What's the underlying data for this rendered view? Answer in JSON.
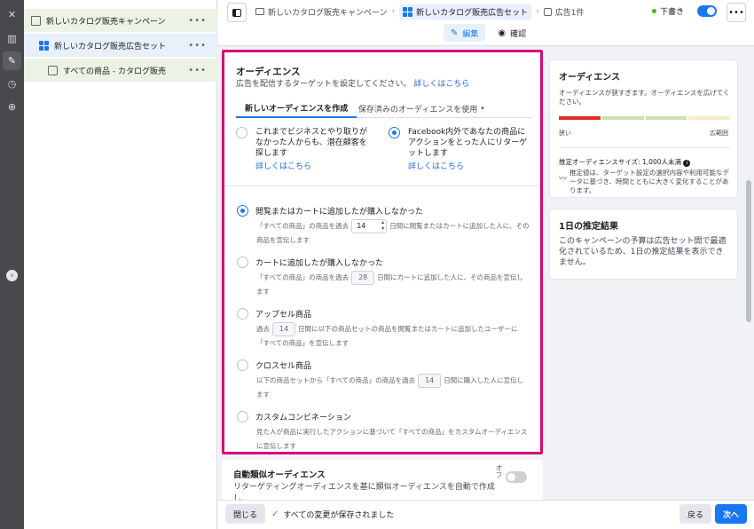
{
  "rail": {
    "icons": [
      "close-icon",
      "chart-icon",
      "pencil-icon",
      "clock-icon",
      "zoom-icon"
    ],
    "close_glyph": "✕",
    "chart_glyph": "▥",
    "pencil_glyph": "✎",
    "clock_glyph": "◷",
    "zoom_glyph": "⊕",
    "collapse_glyph": "‹"
  },
  "tree": {
    "campaign": "新しいカタログ販売キャンペーン",
    "adset": "新しいカタログ販売広告セット",
    "ad": "すべての商品 - カタログ販売",
    "more": "•••"
  },
  "header": {
    "breadcrumbs": [
      "新しいカタログ販売キャンペーン",
      "新しいカタログ販売広告セット",
      "広告1件"
    ],
    "separator": "›",
    "status": "下書き",
    "more": "•••",
    "modes": [
      {
        "label": "編集",
        "icon": "pencil-icon",
        "glyph": "✎"
      },
      {
        "label": "確認",
        "icon": "eye-icon",
        "glyph": "◉"
      }
    ]
  },
  "audience": {
    "title": "オーディエンス",
    "subtitle": "広告を配信するターゲットを設定してください。",
    "learn_more": "詳しくはこちら",
    "tabs": [
      "新しいオーディエンスを作成",
      "保存済みのオーディエンスを使用"
    ],
    "tab_caret": "▾",
    "options": [
      {
        "text": "これまでビジネスとやり取りがなかった人からも、潜在顧客を探します",
        "link": "詳しくはこちら"
      },
      {
        "text": "Facebook内外であなたの商品にアクションをとった人にリターゲットします",
        "link": "詳しくはこちら"
      }
    ],
    "retargeting": [
      {
        "title": "閲覧またはカートに追加したが購入しなかった",
        "pre": "「すべての商品」の商品を過去",
        "days": "14",
        "post": "日間に閲覧またはカートに追加した人に、その商品を宣伝します"
      },
      {
        "title": "カートに追加したが購入しなかった",
        "pre": "「すべての商品」の商品を過去",
        "days": "28",
        "post": "日間にカートに追加した人に、その商品を宣伝します"
      },
      {
        "title": "アップセル商品",
        "pre": "過去",
        "days": "14",
        "post": "日間に以下の商品セットの商品を閲覧またはカートに追加したユーザーに「すべての商品」を宣伝します"
      },
      {
        "title": "クロスセル商品",
        "pre": "以下の商品セットから「すべての商品」の商品を過去",
        "days": "14",
        "post": "日間に購入した人に宣伝します"
      },
      {
        "title": "カスタムコンビネーション",
        "pre": "見た人が商品に実行したアクションに基づいて「すべての商品」をカスタムオーディエンスに宣伝します",
        "days": "",
        "post": ""
      }
    ]
  },
  "auto_lookalike": {
    "title": "自動類似オーディエンス",
    "desc": "リターゲティングオーディエンスを基に類似オーディエンスを自動で作成し",
    "off_label": "オフ"
  },
  "side": {
    "audience_title": "オーディエンス",
    "audience_text": "オーディエンスが狭すぎます。オーディエンスを広げてください。",
    "narrow": "狭い",
    "broad": "広範囲",
    "size_label": "推定オーディエンスサイズ: 1,000人未満",
    "info_glyph": "i",
    "size_note": "推定値は、ターゲット設定の選択内容や利用可能なデータに基づき、時間とともに大きく変化することがあります。",
    "gauge_colors": [
      "#e02f1f",
      "#c9e3a9",
      "#c9e3a9",
      "#f7ebc6"
    ],
    "daily_title": "1日の推定結果",
    "daily_text": "このキャンペーンの予算は広告セット間で最適化されているため、1日の推定結果を表示できません。"
  },
  "footer": {
    "close": "閉じる",
    "saved": "すべての変更が保存されました",
    "back": "戻る",
    "next": "次へ",
    "check_glyph": "✓"
  }
}
